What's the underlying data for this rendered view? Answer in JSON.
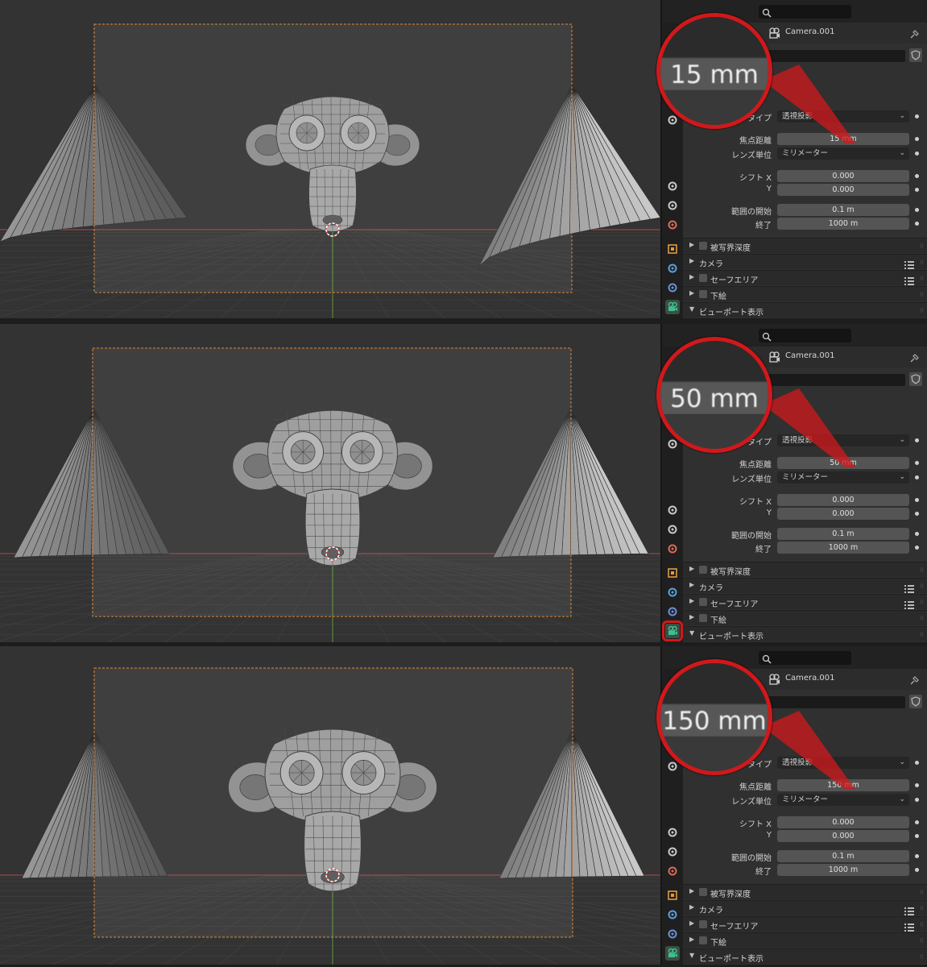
{
  "panels": [
    {
      "object_name": "Camera.001",
      "callout_text": "15 mm",
      "type_label": "タイプ",
      "type_value": "透視投影",
      "focal_label": "焦点距離",
      "focal_value": "15 mm",
      "lens_unit_label": "レンズ単位",
      "lens_unit_value": "ミリメーター",
      "shift_x_label": "シフト X",
      "shift_x_value": "0.000",
      "shift_y_label": "Y",
      "shift_y_value": "0.000",
      "clip_start_label": "範囲の開始",
      "clip_start_value": "0.1 m",
      "clip_end_label": "終了",
      "clip_end_value": "1000 m",
      "sections": [
        "被写界深度",
        "カメラ",
        "セーフエリア",
        "下絵",
        "ビューポート表示"
      ]
    },
    {
      "object_name": "Camera.001",
      "callout_text": "50 mm",
      "type_label": "タイプ",
      "type_value": "透視投影",
      "focal_label": "焦点距離",
      "focal_value": "50 mm",
      "lens_unit_label": "レンズ単位",
      "lens_unit_value": "ミリメーター",
      "shift_x_label": "シフト X",
      "shift_x_value": "0.000",
      "shift_y_label": "Y",
      "shift_y_value": "0.000",
      "clip_start_label": "範囲の開始",
      "clip_start_value": "0.1 m",
      "clip_end_label": "終了",
      "clip_end_value": "1000 m",
      "sections": [
        "被写界深度",
        "カメラ",
        "セーフエリア",
        "下絵",
        "ビューポート表示"
      ]
    },
    {
      "object_name": "Camera.001",
      "callout_text": "150 mm",
      "type_label": "タイプ",
      "type_value": "透視投影",
      "focal_label": "焦点距離",
      "focal_value": "150 mm",
      "lens_unit_label": "レンズ単位",
      "lens_unit_value": "ミリメーター",
      "shift_x_label": "シフト X",
      "shift_x_value": "0.000",
      "shift_y_label": "Y",
      "shift_y_value": "0.000",
      "clip_start_label": "範囲の開始",
      "clip_start_value": "0.1 m",
      "clip_end_label": "終了",
      "clip_end_value": "1000 m",
      "sections": [
        "被写界深度",
        "カメラ",
        "セーフエリア",
        "下絵",
        "ビューポート表示"
      ]
    }
  ],
  "colors": {
    "highlight_red": "#d1181b",
    "camera_frame": "#e08a3a",
    "active_tab": "#3fbf8f",
    "x_axis": "#b04848",
    "y_axis": "#5c9a3a"
  },
  "icons": {
    "search": "search-icon",
    "camera_data": "camera-data-icon",
    "pin": "pin-icon",
    "shield": "fake-user-shield-icon",
    "list": "list-icon"
  }
}
